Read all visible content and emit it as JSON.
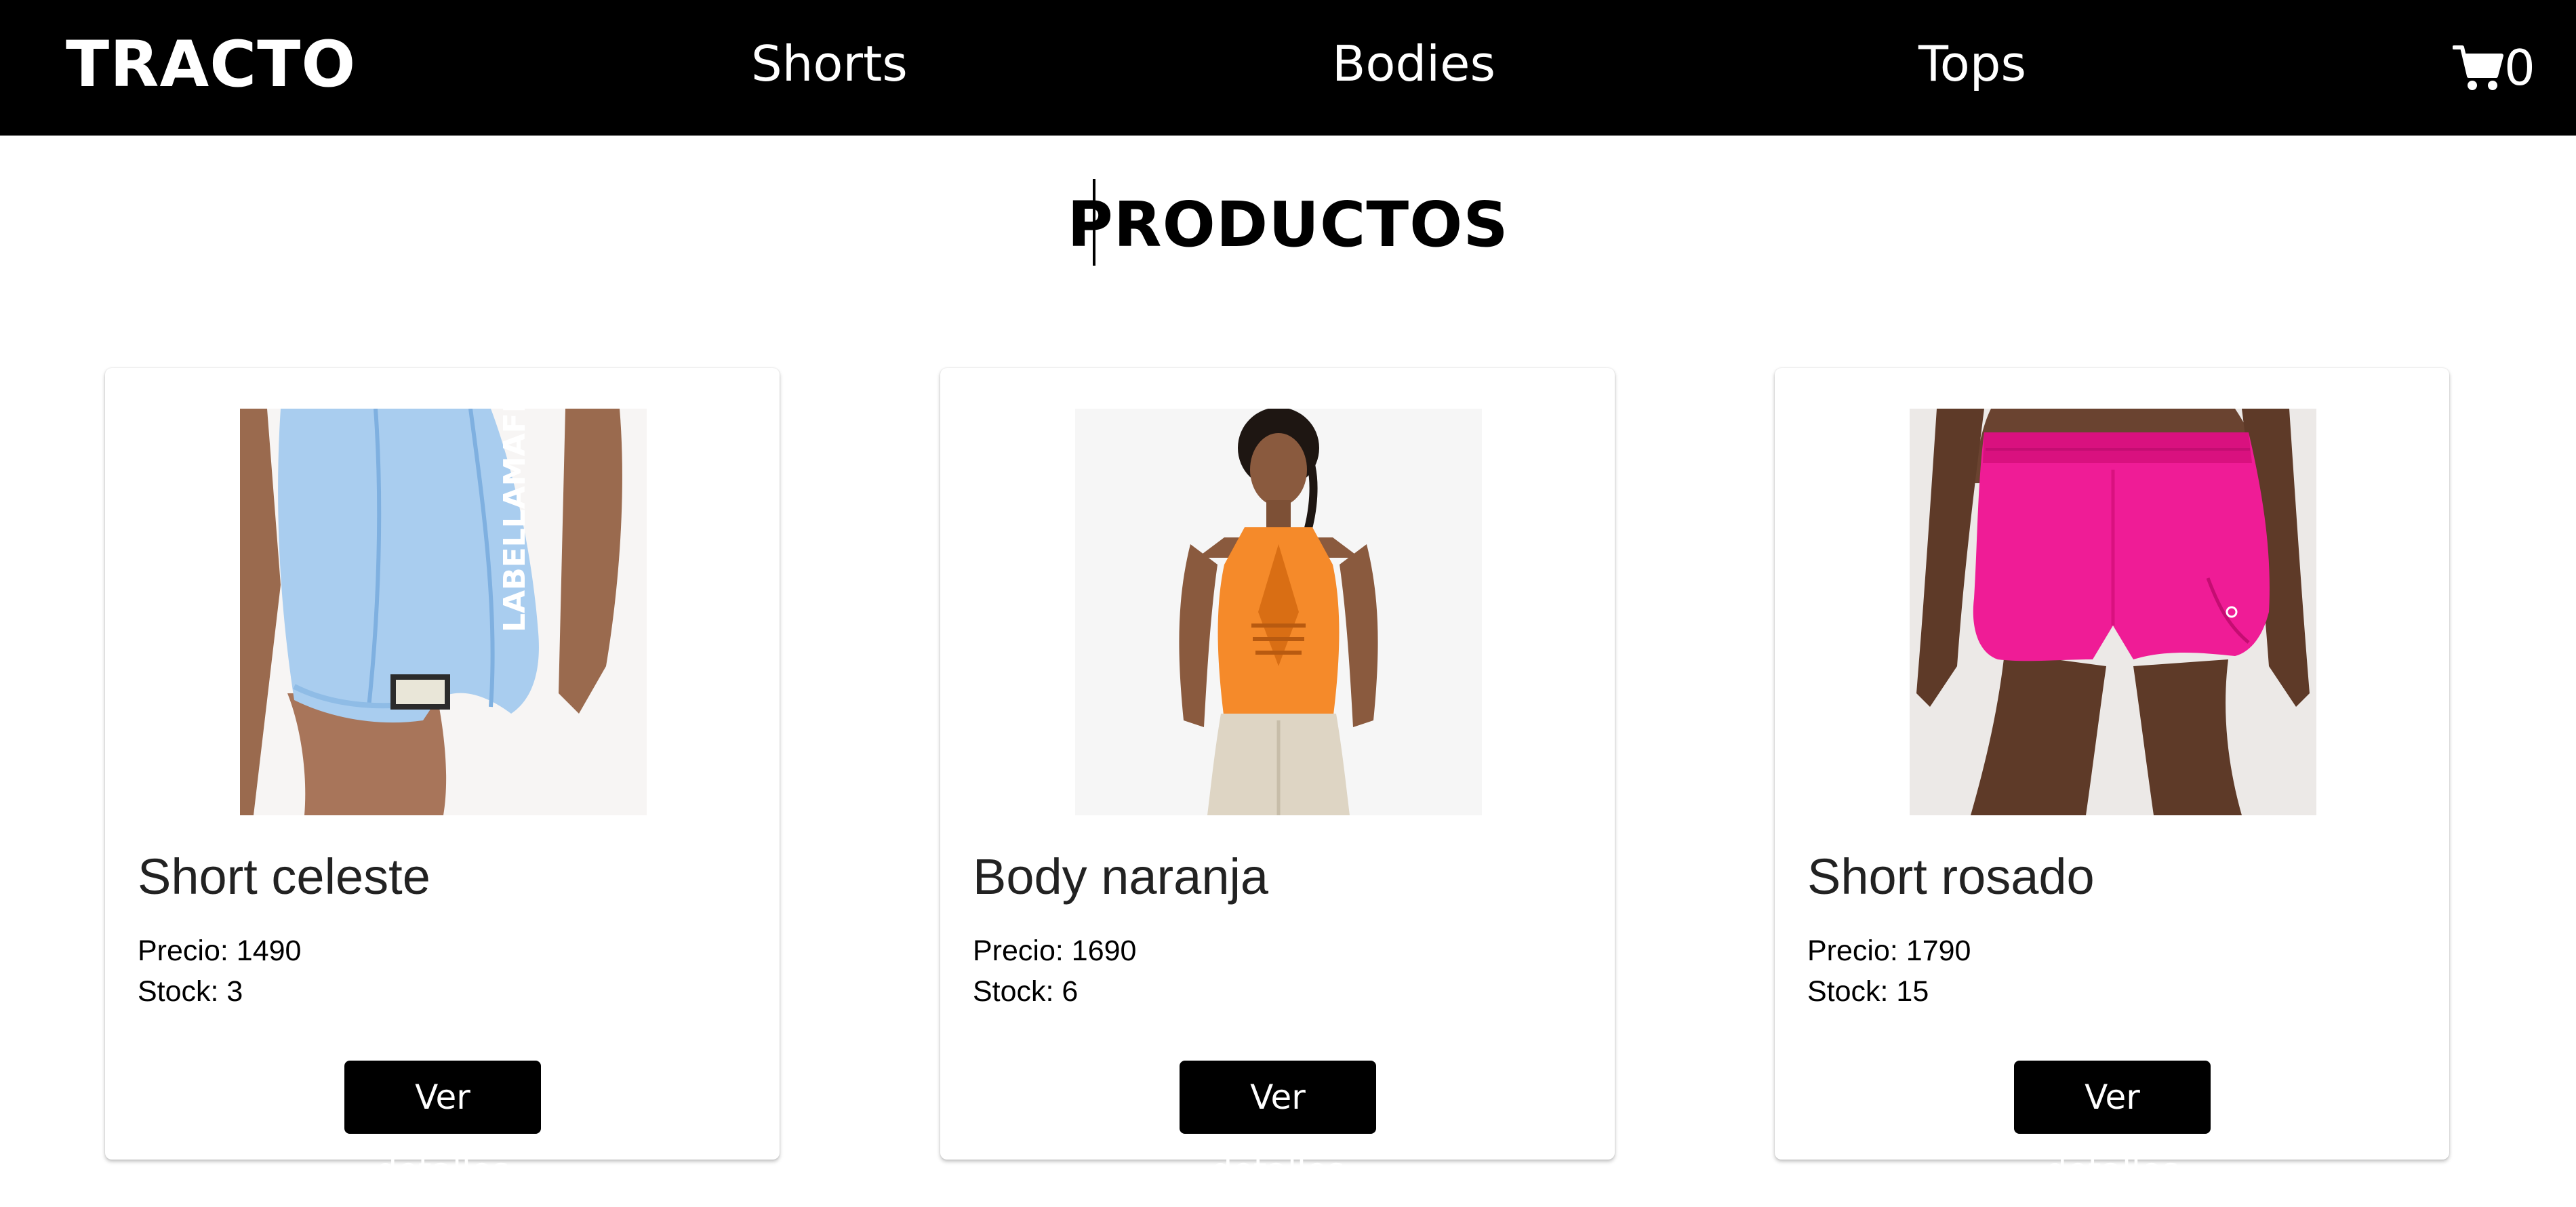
{
  "navbar": {
    "brand": "TRACTO",
    "links": [
      {
        "label": "Shorts"
      },
      {
        "label": "Bodies"
      },
      {
        "label": "Tops"
      }
    ],
    "cart": {
      "icon": "shopping-cart-icon",
      "count": "0"
    }
  },
  "main": {
    "title": "PRODUCTOS"
  },
  "products": [
    {
      "name": "Short celeste",
      "price_label": "Precio: 1490",
      "stock_label": "Stock: 3",
      "button_label": "Ver detalles",
      "image": "light-blue-bike-shorts",
      "garment_color": "#a9cdef",
      "image_text": "LABELLAMAFIA"
    },
    {
      "name": "Body naranja",
      "price_label": "Precio: 1690",
      "stock_label": "Stock: 6",
      "button_label": "Ver detalles",
      "image": "orange-bodysuit",
      "garment_color": "#f58a2a"
    },
    {
      "name": "Short rosado",
      "price_label": "Precio: 1790",
      "stock_label": "Stock: 15",
      "button_label": "Ver detalles",
      "image": "pink-running-shorts",
      "garment_color": "#ef1c96"
    }
  ],
  "colors": {
    "navbar_bg": "#000000",
    "navbar_text": "#ffffff",
    "button_bg": "#000000",
    "button_text": "#ffffff"
  }
}
